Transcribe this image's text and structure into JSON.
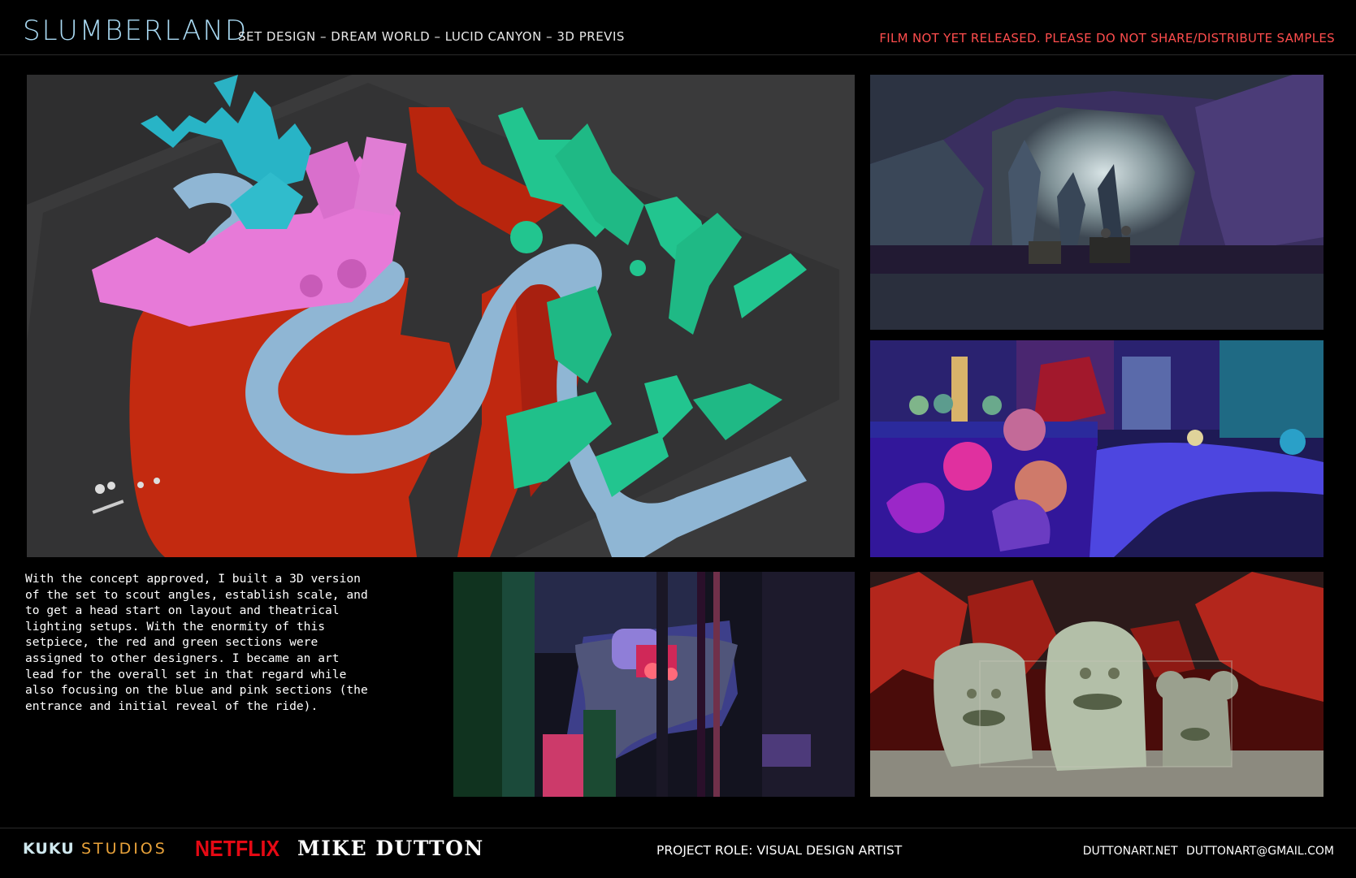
{
  "header": {
    "logo": "SLUMBERLAND",
    "subtitle": "SET DESIGN – DREAM WORLD –  LUCID CANYON – 3D PREVIS",
    "warning": "FILM NOT YET RELEASED. PLEASE DO NOT SHARE/DISTRIBUTE SAMPLES"
  },
  "description": "With the concept approved, I built a 3D version\nof the set to scout angles, establish scale, and\nto get a head start on layout and theatrical\nlighting setups. With the enormity of this\nsetpiece, the red and green sections were\nassigned to other designers. I became an art\nlead for the overall set in that regard while\nalso focusing on the blue and pink sections (the\nentrance and initial reveal of the ride).",
  "footer": {
    "studio_logo": "KUKU",
    "studio_logo_suffix": "STUDIOS",
    "distributor": "NETFLIX",
    "artist": "MIKE DUTTON",
    "role": "PROJECT ROLE: VISUAL DESIGN ARTIST",
    "contact": "DUTTONART.NET  DUTTONART@GMAIL.COM"
  },
  "colors": {
    "logo": "#a9d9f2",
    "warning": "#ff4d4d",
    "netflix": "#e50914",
    "previs_red": "#c32a10",
    "previs_green": "#22c58f",
    "previs_blue": "#8fb6d4",
    "previs_pink": "#e77ad8",
    "previs_cyan": "#28b4c6"
  }
}
